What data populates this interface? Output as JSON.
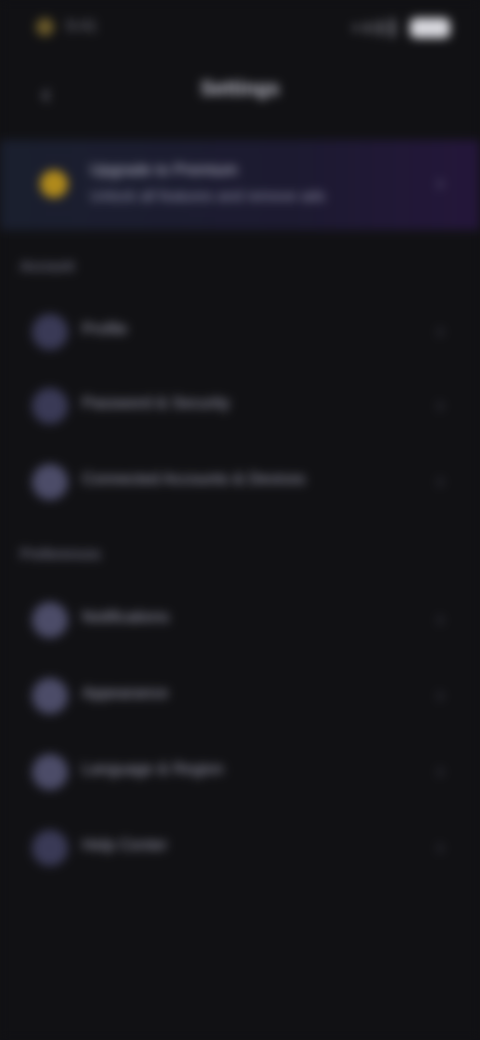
{
  "status_bar": {
    "time": "9:41"
  },
  "header": {
    "back_icon": "chevron-left-icon",
    "title": "Settings"
  },
  "banner": {
    "icon": "star-icon",
    "line1": "Upgrade to Premium",
    "line2": "Unlock all features and remove ads",
    "chevron_icon": "chevron-right-icon"
  },
  "sections": [
    {
      "label": "Account",
      "items": [
        {
          "label": "Profile",
          "icon": "user-icon"
        },
        {
          "label": "Password & Security",
          "icon": "lock-icon"
        },
        {
          "label": "Connected Accounts & Devices",
          "icon": "link-icon"
        }
      ]
    },
    {
      "label": "Preferences",
      "items": [
        {
          "label": "Notifications",
          "icon": "bell-icon"
        },
        {
          "label": "Appearance",
          "icon": "palette-icon"
        },
        {
          "label": "Language & Region",
          "icon": "globe-icon"
        },
        {
          "label": "Help Center",
          "icon": "help-icon"
        }
      ]
    }
  ],
  "colors": {
    "background": "#111114",
    "banner_start": "#1a1f2e",
    "banner_end": "#24163a",
    "banner_icon": "#b08a1c",
    "row_icon": "#3a3a56"
  }
}
